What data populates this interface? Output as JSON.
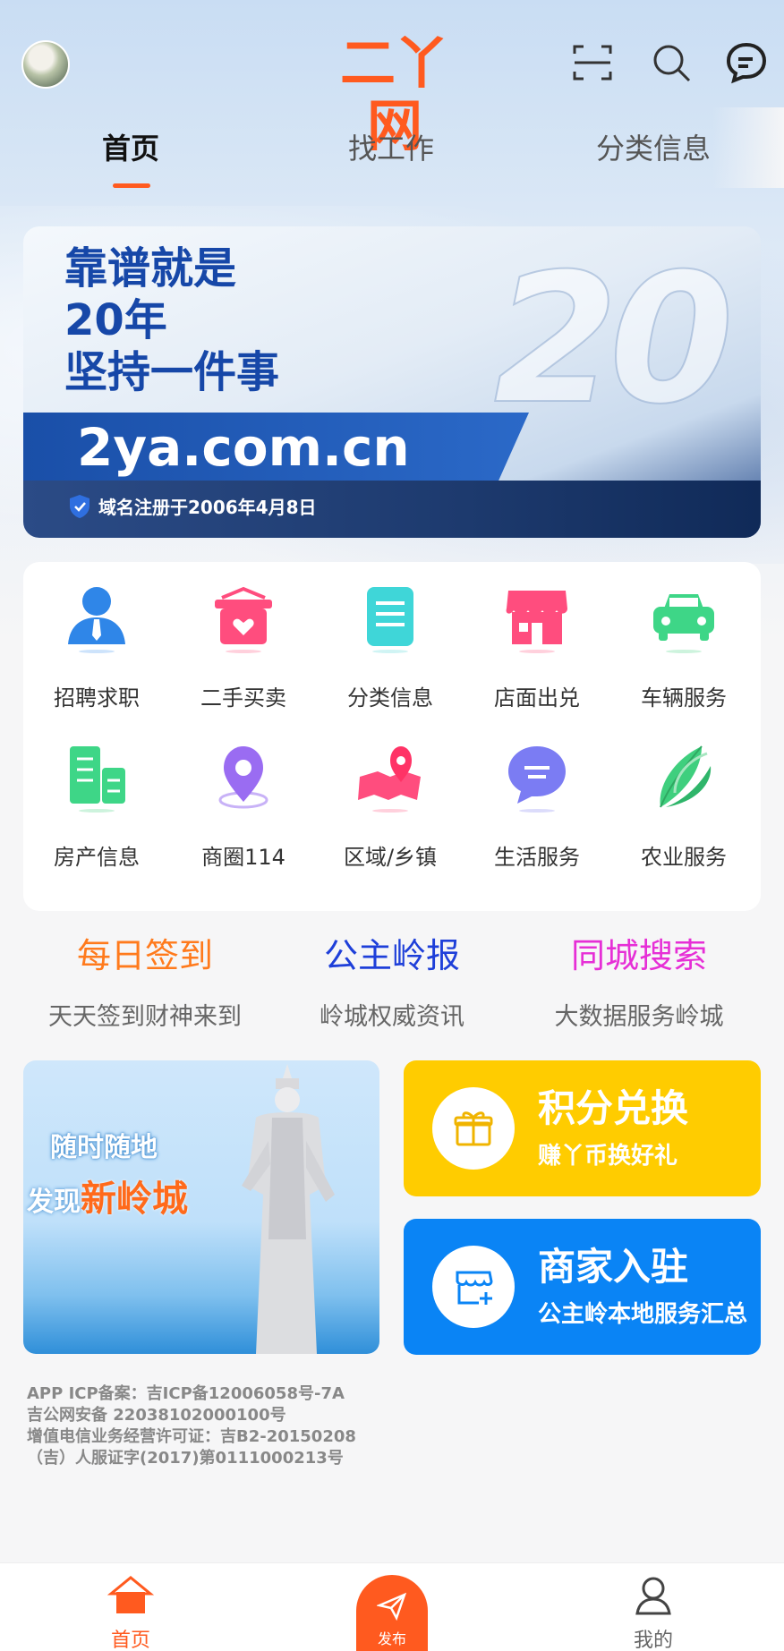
{
  "header": {
    "logo": "二丫网",
    "icons": [
      "scan-icon",
      "search-icon",
      "message-icon"
    ]
  },
  "tabs": [
    {
      "label": "首页",
      "active": true
    },
    {
      "label": "找工作",
      "active": false
    },
    {
      "label": "分类信息",
      "active": false
    }
  ],
  "banner": {
    "line1": "靠谱就是",
    "line2": "20年",
    "line3": "坚持一件事",
    "big_number": "20",
    "domain": "2ya.com.cn",
    "registration": "域名注册于2006年4月8日"
  },
  "categories": [
    {
      "label": "招聘求职",
      "icon": "person-icon",
      "color": "#2f86e8"
    },
    {
      "label": "二手买卖",
      "icon": "basket-icon",
      "color": "#ff4d7e"
    },
    {
      "label": "分类信息",
      "icon": "document-icon",
      "color": "#3fd6d8"
    },
    {
      "label": "店面出兑",
      "icon": "shop-icon",
      "color": "#ff4d7e"
    },
    {
      "label": "车辆服务",
      "icon": "car-icon",
      "color": "#3ed687"
    },
    {
      "label": "房产信息",
      "icon": "buildings-icon",
      "color": "#3ed687"
    },
    {
      "label": "商圈114",
      "icon": "location-pin-icon",
      "color": "#9a6cf2"
    },
    {
      "label": "区域/乡镇",
      "icon": "map-icon",
      "color": "#ff4d7e"
    },
    {
      "label": "生活服务",
      "icon": "chat-bubble-icon",
      "color": "#7b7cf3"
    },
    {
      "label": "农业服务",
      "icon": "corn-icon",
      "color": "#3fcf7e"
    }
  ],
  "features": [
    {
      "title": "每日签到",
      "subtitle": "天天签到财神来到",
      "color": "#ff7a1c"
    },
    {
      "title": "公主岭报",
      "subtitle": "岭城权威资讯",
      "color": "#1e3fd9"
    },
    {
      "title": "同城搜索",
      "subtitle": "大数据服务岭城",
      "color": "#e62fd6"
    }
  ],
  "promo_left": {
    "line1": "随时随地",
    "line2_prefix": "发现",
    "line2_highlight": "新岭城"
  },
  "promo_points": {
    "title": "积分兑换",
    "subtitle": "赚丫币换好礼",
    "icon": "gift-icon",
    "bg": "#ffcc00"
  },
  "promo_merchant": {
    "title": "商家入驻",
    "subtitle": "公主岭本地服务汇总",
    "icon": "store-add-icon",
    "bg": "#0a84f5"
  },
  "icp": [
    "APP ICP备案：吉ICP备12006058号-7A",
    "吉公网安备 22038102000100号",
    "增值电信业务经营许可证：吉B2-20150208",
    "（吉）人服证字(2017)第0111000213号"
  ],
  "bottom_nav": {
    "home": "首页",
    "publish": "发布",
    "mine": "我的"
  }
}
